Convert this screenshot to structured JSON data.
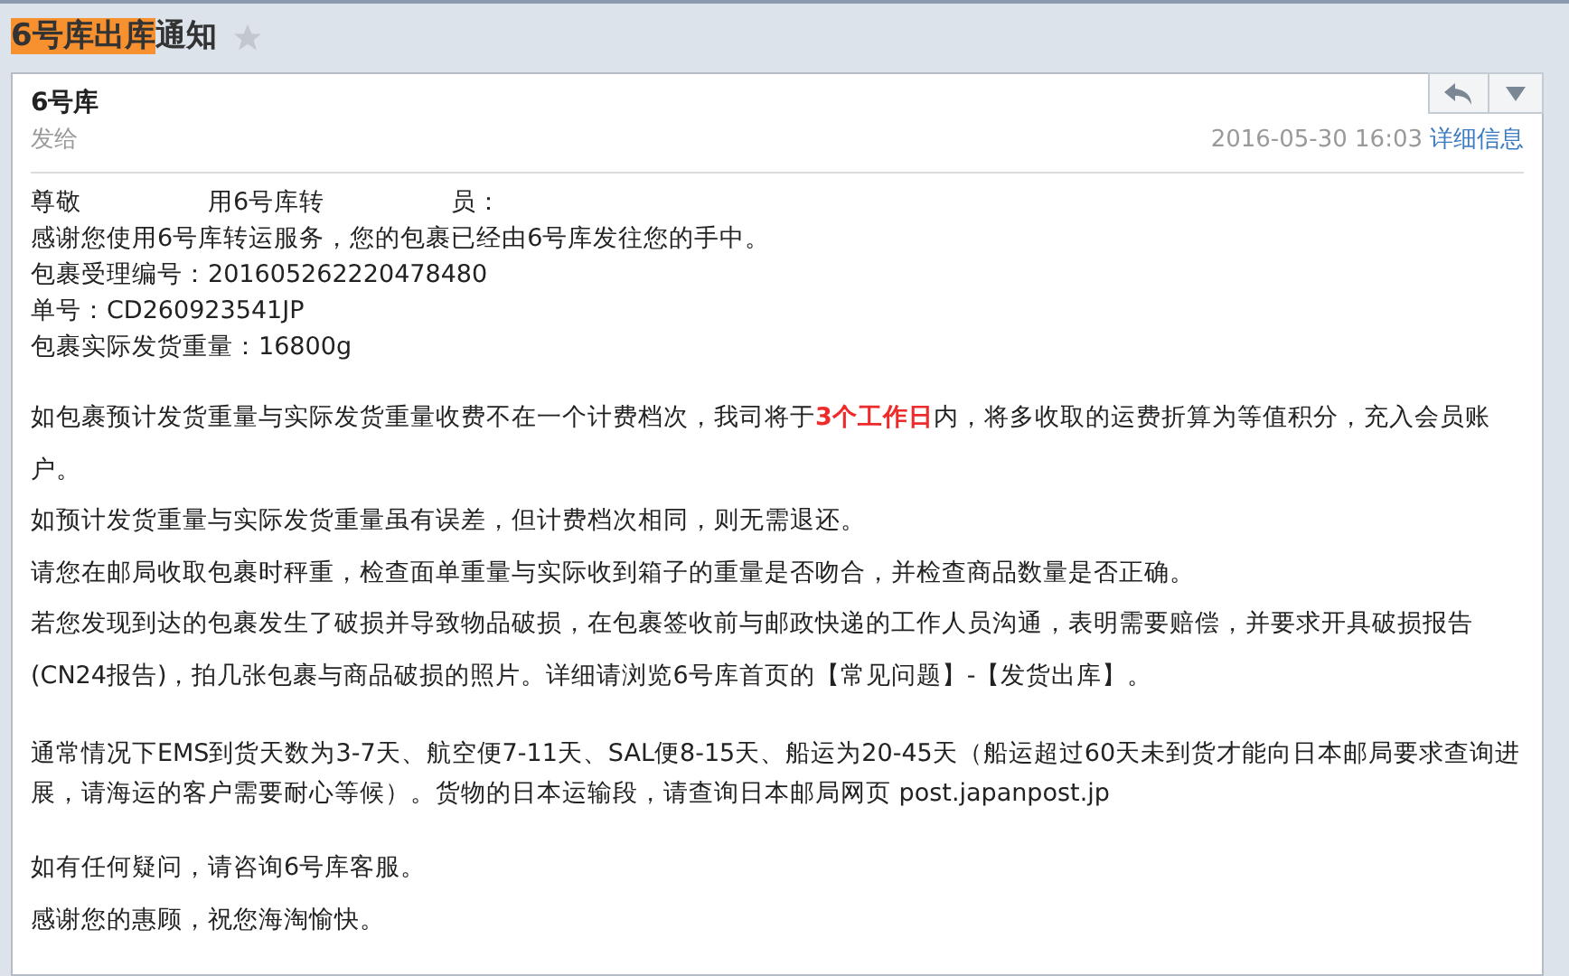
{
  "title": {
    "highlighted": "6号库出库",
    "rest": "通知",
    "starred": false
  },
  "message": {
    "sender": "6号库",
    "to_label": "发给",
    "date": "2016-05-30 16:03",
    "details_link": "详细信息",
    "greeting": [
      "尊敬",
      "用6号库转",
      "员："
    ],
    "block1": [
      "感谢您使用6号库转运服务，您的包裹已经由6号库发往您的手中。",
      "包裹受理编号：201605262220478480",
      "单号：CD260923541JP",
      "包裹实际发货重量：16800g"
    ],
    "block2": [
      "如包裹预计发货重量与实际发货重量收费不在一个计费档次，我司将于**3个工作日**内，将多收取的运费折算为等值积分，充入会员账户。",
      "如预计发货重量与实际发货重量虽有误差，但计费档次相同，则无需退还。",
      "请您在邮局收取包裹时秤重，检查面单重量与实际收到箱子的重量是否吻合，并检查商品数量是否正确。",
      "若您发现到达的包裹发生了破损并导致物品破损，在包裹签收前与邮政快递的工作人员沟通，表明需要赔偿，并要求开具破损报告(CN24报告)，拍几张包裹与商品破损的照片。详细请浏览6号库首页的【常见问题】-【发货出库】。"
    ],
    "block3": [
      "通常情况下EMS到货天数为3-7天、航空便7-11天、SAL便8-15天、船运为20-45天（船运超过60天未到货才能向日本邮局要求查询进展，请海运的客户需要耐心等候）。货物的日本运输段，请查询日本邮局网页 post.japanpost.jp"
    ],
    "block4": [
      "如有任何疑问，请咨询6号库客服。",
      "感谢您的惠顾，祝您海淘愉快。"
    ]
  }
}
